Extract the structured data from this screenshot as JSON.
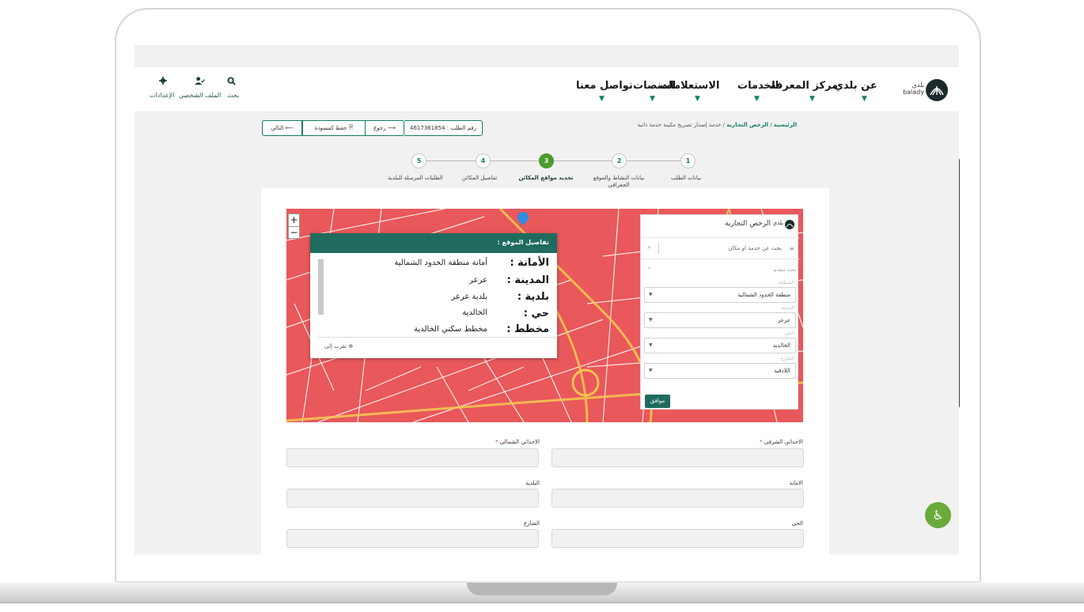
{
  "header": {
    "logo_text": "بلدي",
    "logo_latin": "balady",
    "nav": [
      {
        "label": "عن بلدي"
      },
      {
        "label": "مركز المعرفة"
      },
      {
        "label": "الخدمات"
      },
      {
        "label": "الاستعلامات"
      },
      {
        "label": "المنصات"
      },
      {
        "label": "تواصل معنا"
      }
    ],
    "utilities": [
      {
        "label": "بحث",
        "icon": "search-icon"
      },
      {
        "label": "الملف الشخصي",
        "icon": "user-icon"
      },
      {
        "label": "الإعدادات",
        "icon": "gear-icon"
      }
    ]
  },
  "breadcrumb": {
    "home": "الرئيسية",
    "section": "الرخص التجارية",
    "current": "خدمة إصدار تصريح مكينة خدمة ذاتية",
    "sep": "/"
  },
  "actions": {
    "request_number": "رقم الطلب : 4617361854",
    "back": "رجوع",
    "save_draft": "حفظ كمسودة",
    "next": "التالي"
  },
  "steps": [
    {
      "num": "1",
      "label": "بيانات الطلب"
    },
    {
      "num": "2",
      "label": "بيانات النشاط والموقع الجغرافي"
    },
    {
      "num": "3",
      "label": "تحديد مواقع المكائن"
    },
    {
      "num": "4",
      "label": "تفاصيل المكائن"
    },
    {
      "num": "5",
      "label": "الطلبات المرسلة للبلدية"
    }
  ],
  "map": {
    "zoom_in": "+",
    "zoom_out": "−",
    "popup": {
      "title": "تفاصيل الموقع :",
      "rows": [
        {
          "label": "الأمانة :",
          "value": "أمانة منطقة الحدود الشمالية"
        },
        {
          "label": "المدينة :",
          "value": "عرعر"
        },
        {
          "label": "بلدية :",
          "value": "بلدية عرعر"
        },
        {
          "label": "حي :",
          "value": "الخالدية"
        },
        {
          "label": "مخطط :",
          "value": "مخطط سكني الخالدية"
        }
      ],
      "zoom_to": "تقرب إلى"
    },
    "panel": {
      "title": "الرخص التجارية",
      "logo": "بلدي",
      "search_placeholder": "بحث عن خدمة او مكان",
      "advanced": "بحث متقدم",
      "fields": [
        {
          "label": "المنطقة",
          "value": "منطقة الحدود الشمالية"
        },
        {
          "label": "المدينة",
          "value": "عرعر"
        },
        {
          "label": "الحي",
          "value": "الخالدية"
        },
        {
          "label": "الشارع",
          "value": "اللاذقية"
        }
      ],
      "ok": "موافق"
    },
    "accent": "#1f6b5f",
    "background": "#e9585a"
  },
  "form": {
    "east": "الاحداثي الشرقي",
    "north": "الاحداثي الشمالي",
    "amana": "الامانة",
    "baladia": "البلدية",
    "district": "الحي",
    "street": "الشارع",
    "required_mark": "*"
  },
  "colors": {
    "brand": "#127e69",
    "step_active": "#4d9a2c",
    "accessibility": "#6aaa3a"
  }
}
